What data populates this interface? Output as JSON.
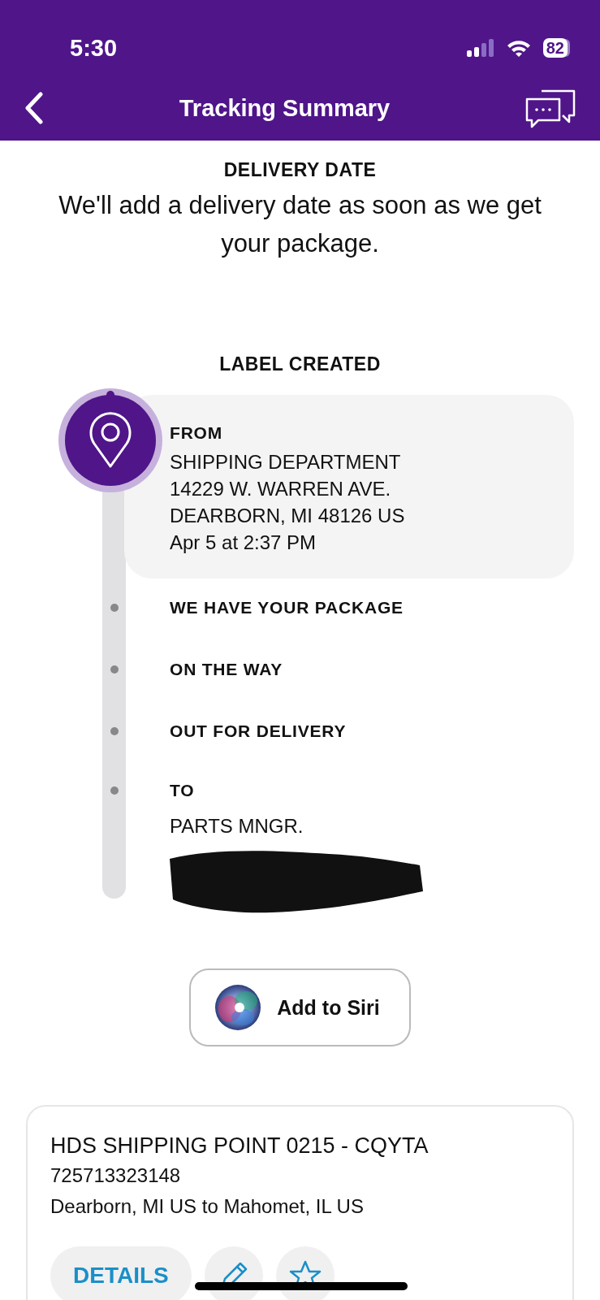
{
  "status_bar": {
    "time": "5:30",
    "battery": "82"
  },
  "nav": {
    "title": "Tracking Summary"
  },
  "delivery": {
    "heading": "DELIVERY DATE",
    "message": "We'll add a delivery date as soon as we get your package."
  },
  "timeline": {
    "heading": "LABEL CREATED",
    "steps": [
      {
        "kind": "origin",
        "title": "FROM",
        "current": true,
        "lines": [
          "SHIPPING DEPARTMENT",
          "14229 W. WARREN AVE.",
          "DEARBORN, MI 48126 US",
          "Apr 5 at 2:37 PM"
        ]
      },
      {
        "kind": "milestone",
        "title": "WE HAVE YOUR PACKAGE",
        "current": false
      },
      {
        "kind": "milestone",
        "title": "ON THE WAY",
        "current": false
      },
      {
        "kind": "milestone",
        "title": "OUT FOR DELIVERY",
        "current": false
      },
      {
        "kind": "destination",
        "title": "TO",
        "current": false,
        "redacted": true,
        "lines": [
          "PARTS MNGR."
        ]
      }
    ]
  },
  "siri_button": {
    "label": "Add to Siri"
  },
  "shipment": {
    "name": "HDS SHIPPING POINT 0215 - CQYTA",
    "tracking_number": "725713323148",
    "route": "Dearborn, MI US to Mahomet, IL US",
    "actions": [
      {
        "kind": "details",
        "label": "DETAILS"
      },
      {
        "kind": "edit"
      },
      {
        "kind": "favorite"
      }
    ]
  }
}
